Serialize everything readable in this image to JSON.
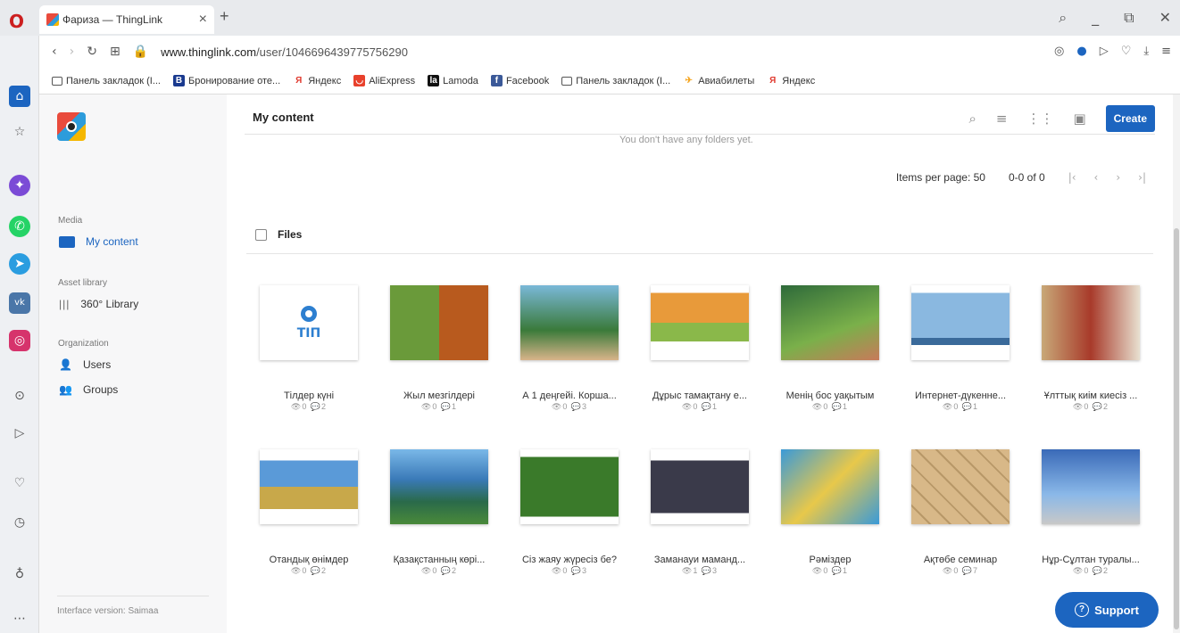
{
  "browser": {
    "tab_title": "Фариза — ThingLink",
    "new_tab": "+",
    "url_host": "www.thinglink.com",
    "url_path": "/user/1046696439775756290"
  },
  "bookmarks": [
    {
      "label": "Панель закладок (I...",
      "icon": "folder-icon"
    },
    {
      "label": "Бронирование оте...",
      "icon": "booking-icon",
      "color": "#1a3a8f"
    },
    {
      "label": "Яндекс",
      "icon": "yandex-icon",
      "color": "#e03a2f"
    },
    {
      "label": "AliExpress",
      "icon": "aliexpress-icon",
      "color": "#e8412c"
    },
    {
      "label": "Lamoda",
      "icon": "lamoda-icon",
      "color": "#111111"
    },
    {
      "label": "Facebook",
      "icon": "facebook-icon",
      "color": "#3b5998"
    },
    {
      "label": "Панель закладок (I...",
      "icon": "folder-icon"
    },
    {
      "label": "Авиабилеты",
      "icon": "plane-icon",
      "color": "#f5a623"
    },
    {
      "label": "Яндекс",
      "icon": "yandex-icon",
      "color": "#e03a2f"
    }
  ],
  "sidebar": {
    "media_label": "Media",
    "my_content": "My content",
    "asset_label": "Asset library",
    "library": "360° Library",
    "org_label": "Organization",
    "users": "Users",
    "groups": "Groups",
    "interface_version": "Interface version: Saimaa"
  },
  "header": {
    "title": "My content",
    "create": "Create"
  },
  "no_folders": "You don't have any folders yet.",
  "pager": {
    "items_per_page": "Items per page: 50",
    "range": "0-0 of 0"
  },
  "files_label": "Files",
  "files": [
    {
      "title": "Тілдер күні",
      "stats": "👁0 💬2"
    },
    {
      "title": "Жыл мезгілдері",
      "stats": "👁0 💬1"
    },
    {
      "title": "А 1 деңгейі. Корша...",
      "stats": "👁0 💬3"
    },
    {
      "title": "Дұрыс тамақтану е...",
      "stats": "👁0 💬1"
    },
    {
      "title": "Менің бос уақытым",
      "stats": "👁0 💬1"
    },
    {
      "title": "Интернет-дүкенне...",
      "stats": "👁0 💬1"
    },
    {
      "title": "Ұлттық киім киесіз ...",
      "stats": "👁0 💬2"
    },
    {
      "title": "Отандық өнімдер",
      "stats": "👁0 💬2"
    },
    {
      "title": "Қазақстанның көрі...",
      "stats": "👁0 💬2"
    },
    {
      "title": "Сіз жаяу жүресіз бе?",
      "stats": "👁0 💬3"
    },
    {
      "title": "Заманауи маманд...",
      "stats": "👁1 💬3"
    },
    {
      "title": "Рәміздер",
      "stats": "👁0 💬1"
    },
    {
      "title": "Ақтөбе семинар",
      "stats": "👁0 💬7"
    },
    {
      "title": "Нұр-Сұлтан туралы...",
      "stats": "👁0 💬2"
    }
  ],
  "support": "Support"
}
